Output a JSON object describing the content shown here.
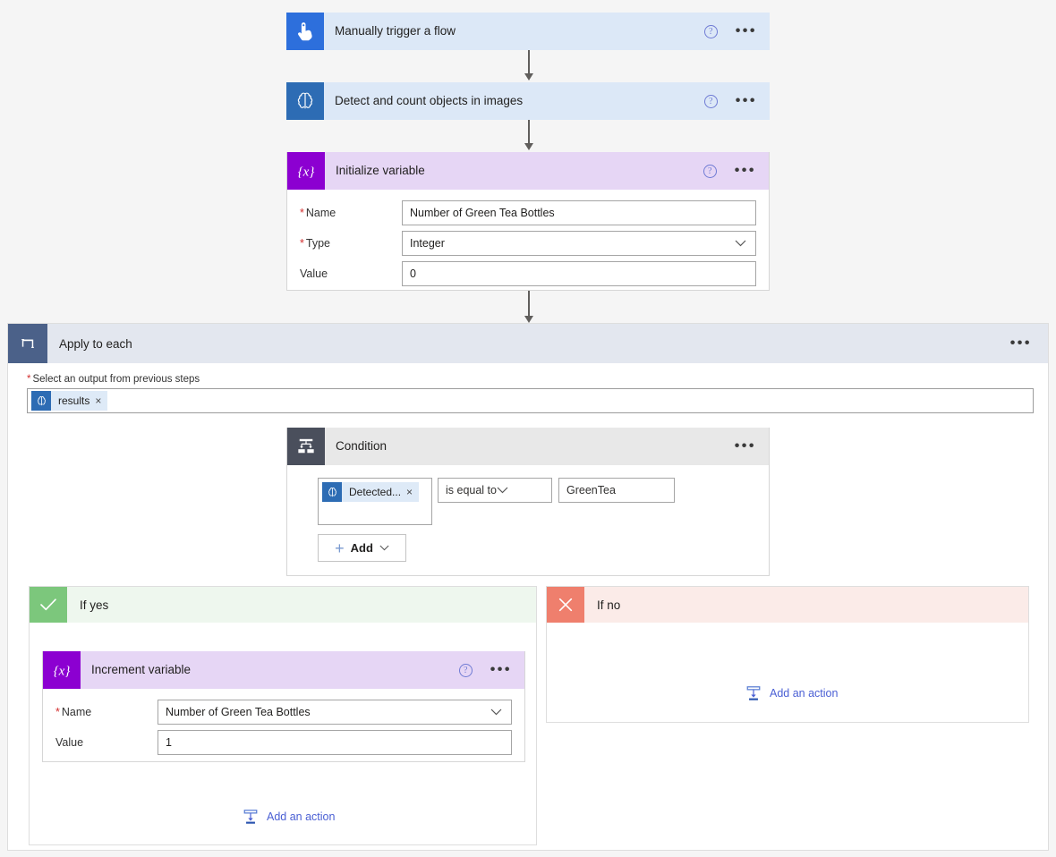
{
  "flow": {
    "trigger": {
      "title": "Manually trigger a flow",
      "icon": "hand-tap-icon",
      "help": "?",
      "menu": "•••"
    },
    "detect_action": {
      "title": "Detect and count objects in images",
      "icon": "brain-icon",
      "help": "?",
      "menu": "•••"
    },
    "initialize_variable": {
      "title": "Initialize variable",
      "icon": "variable-braces-icon",
      "help": "?",
      "menu": "•••",
      "fields": [
        {
          "label": "Name",
          "required": true,
          "value": "Number of Green Tea Bottles",
          "dropdown": false
        },
        {
          "label": "Type",
          "required": true,
          "value": "Integer",
          "dropdown": true
        },
        {
          "label": "Value",
          "required": false,
          "value": "0",
          "dropdown": false
        }
      ]
    },
    "apply_to_each": {
      "title": "Apply to each",
      "icon": "loop-icon",
      "menu": "•••",
      "picker_label": "Select an output from previous steps",
      "picker_required": true,
      "token": {
        "label": "results",
        "icon": "brain-icon",
        "remove": "×"
      }
    },
    "condition": {
      "title": "Condition",
      "icon": "condition-branch-icon",
      "menu": "•••",
      "left_token": {
        "label": "Detected...",
        "icon": "brain-icon",
        "remove": "×"
      },
      "operator": "is equal to",
      "right_value": "GreenTea",
      "add_button": {
        "label": "Add",
        "plus": "+"
      }
    },
    "if_yes": {
      "title": "If yes",
      "icon": "check-icon",
      "increment_variable": {
        "title": "Increment variable",
        "icon": "variable-braces-icon",
        "help": "?",
        "menu": "•••",
        "fields": [
          {
            "label": "Name",
            "required": true,
            "value": "Number of Green Tea Bottles",
            "dropdown": true
          },
          {
            "label": "Value",
            "required": false,
            "value": "1",
            "dropdown": false
          }
        ]
      },
      "add_action": {
        "label": "Add an action",
        "icon": "add-action-icon"
      }
    },
    "if_no": {
      "title": "If no",
      "icon": "close-x-icon",
      "add_action": {
        "label": "Add an action",
        "icon": "add-action-icon"
      }
    }
  },
  "colors": {
    "canvas_bg": "#f5f5f5",
    "trigger_header": "#dce8f7",
    "variable_header": "#e6d6f5",
    "variable_icon": "#8c00d1",
    "condition_icon": "#4a4f5c",
    "loop_icon": "#4b6189",
    "yes_icon": "#7cc77c",
    "no_icon": "#ef7f6d",
    "link_blue": "#4a5fd4",
    "required_red": "#d32f2f"
  }
}
